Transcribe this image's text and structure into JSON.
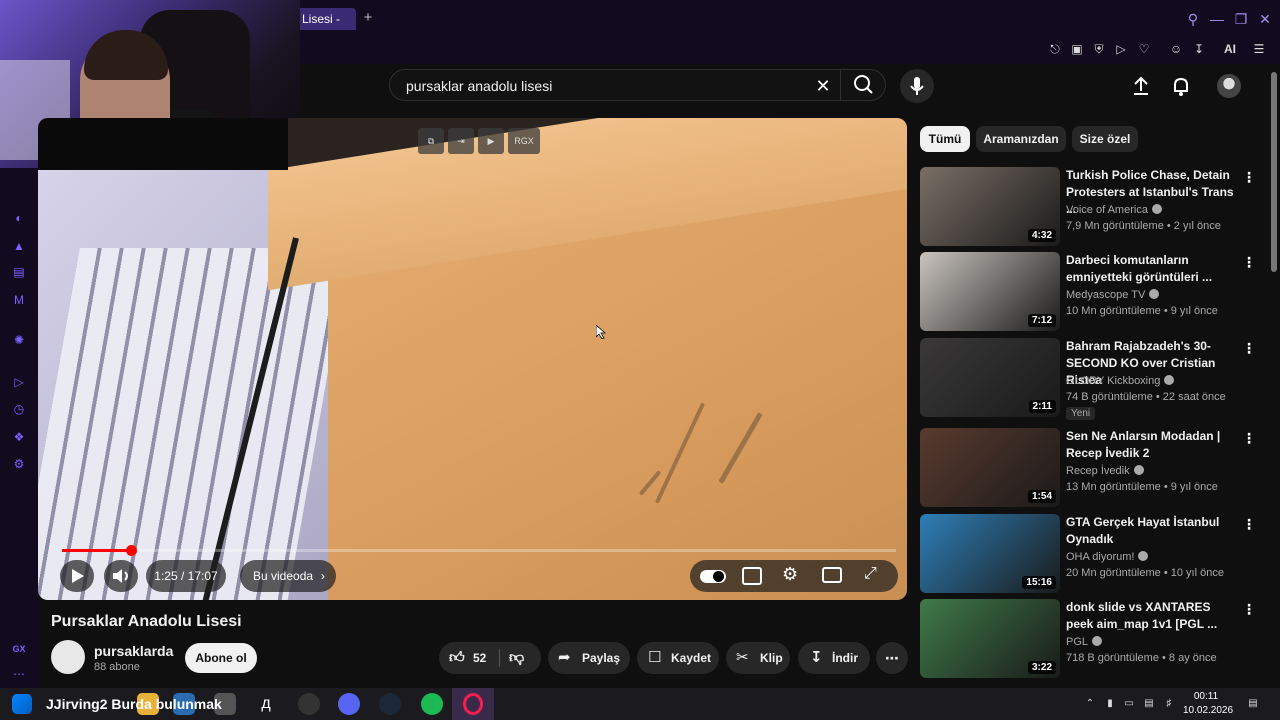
{
  "browser": {
    "tab_title": "Lisesi -",
    "new_tab": "+",
    "ai_label": "AI"
  },
  "search": {
    "query": "pursaklar anadolu lisesi"
  },
  "player": {
    "time": "1:25 / 17:07",
    "chapter_button": "Bu videoda",
    "progress": 0.083,
    "top_buttons": [
      "RGX"
    ]
  },
  "video": {
    "title": "Pursaklar Anadolu Lisesi",
    "channel": "pursaklarda",
    "subscribers": "88 abone",
    "subscribe_label": "Abone ol",
    "like_count": "52",
    "share_label": "Paylaş",
    "save_label": "Kaydet",
    "clip_label": "Klip",
    "download_label": "İndir"
  },
  "chips": [
    {
      "label": "Tümü",
      "active": true
    },
    {
      "label": "Aramanızdan",
      "active": false
    },
    {
      "label": "Size özel",
      "active": false
    }
  ],
  "recommendations": [
    {
      "title": "Turkish Police Chase, Detain Protesters at Istanbul's Trans ...",
      "channel": "Voice of America",
      "meta": "7,9 Mn görüntüleme • 2 yıl önce",
      "duration": "4:32",
      "thumb_color": "#7a6f66",
      "verified": true
    },
    {
      "title": "Darbeci komutanların emniyetteki görüntüleri ...",
      "channel": "Medyascope TV",
      "meta": "10 Mn görüntüleme • 9 yıl önce",
      "duration": "7:12",
      "thumb_color": "#c9c4bf",
      "verified": true
    },
    {
      "title": "Bahram Rajabzadeh's 30-SECOND KO over Cristian Ristea",
      "channel": "GLORY Kickboxing",
      "meta": "74 B görüntüleme • 22 saat önce",
      "duration": "2:11",
      "thumb_color": "#3a3838",
      "verified": true,
      "badge": "Yeni"
    },
    {
      "title": "Sen Ne Anlarsın Modadan | Recep İvedik 2",
      "channel": "Recep İvedik",
      "meta": "13 Mn görüntüleme • 9 yıl önce",
      "duration": "1:54",
      "thumb_color": "#5a3a2e",
      "verified": true
    },
    {
      "title": "GTA Gerçek Hayat İstanbul Oynadık",
      "channel": "OHA diyorum!",
      "meta": "20 Mn görüntüleme • 10 yıl önce",
      "duration": "15:16",
      "thumb_color": "#2e7fb8",
      "verified": true
    },
    {
      "title": "donk slide vs XANTARES peek aim_map 1v1 [PGL ...",
      "channel": "PGL",
      "meta": "718 B görüntüleme • 8 ay önce",
      "duration": "3:22",
      "thumb_color": "#3f7a48",
      "verified": true
    }
  ],
  "taskbar": {
    "overlay_text": "JJirving2 Burda bulunmak",
    "time": "00:11",
    "date": "10.02.2026"
  },
  "sidebar_label": "GX",
  "colors": {
    "accent": "#7b61ff",
    "youtube_red": "#ff0000",
    "background": "#0f0f0f"
  }
}
